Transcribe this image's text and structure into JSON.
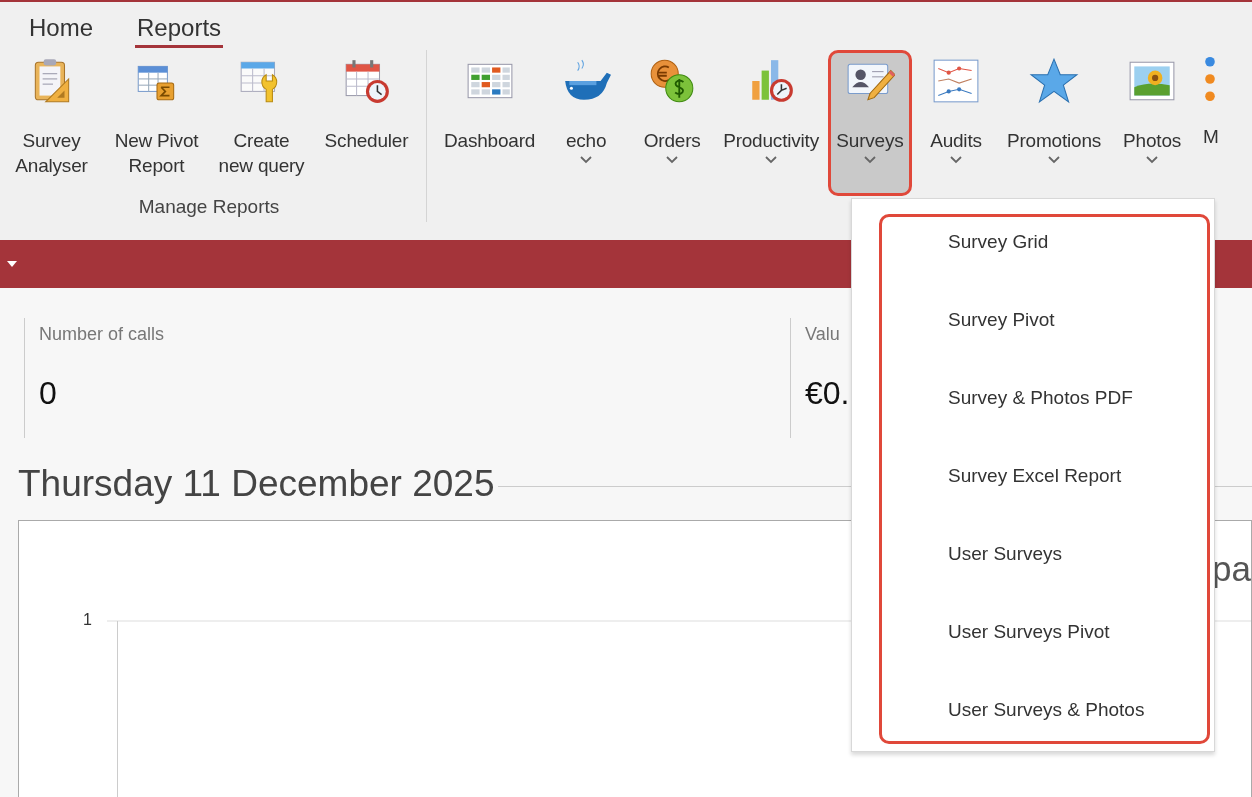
{
  "tabs": [
    {
      "label": "Home",
      "selected": false
    },
    {
      "label": "Reports",
      "selected": true
    }
  ],
  "ribbon_groups": [
    {
      "label": "Manage Reports",
      "buttons": [
        {
          "label": "Survey\nAnalyser",
          "dropdown": false,
          "selected": false,
          "highlighted": false
        },
        {
          "label": "New Pivot\nReport",
          "dropdown": false,
          "selected": false,
          "highlighted": false
        },
        {
          "label": "Create\nnew query",
          "dropdown": false,
          "selected": false,
          "highlighted": false
        },
        {
          "label": "Scheduler",
          "dropdown": false,
          "selected": false,
          "highlighted": false
        }
      ]
    },
    {
      "buttons": [
        {
          "label": "Dashboard",
          "dropdown": false,
          "selected": false,
          "highlighted": false
        },
        {
          "label": "echo",
          "dropdown": true,
          "selected": false,
          "highlighted": false
        },
        {
          "label": "Orders",
          "dropdown": true,
          "selected": false,
          "highlighted": false
        },
        {
          "label": "Productivity",
          "dropdown": true,
          "selected": false,
          "highlighted": false
        },
        {
          "label": "Surveys",
          "dropdown": true,
          "selected": true,
          "highlighted": true
        },
        {
          "label": "Audits",
          "dropdown": true,
          "selected": false,
          "highlighted": false
        },
        {
          "label": "Promotions",
          "dropdown": true,
          "selected": false,
          "highlighted": false
        },
        {
          "label": "Photos",
          "dropdown": true,
          "selected": false,
          "highlighted": false
        },
        {
          "label": "M",
          "dropdown": false,
          "selected": false,
          "highlighted": false
        }
      ]
    }
  ],
  "kpis": [
    {
      "label": "Number of calls",
      "value": "0"
    },
    {
      "label": "Valu",
      "value": "€0."
    }
  ],
  "date_heading": "Thursday 11 December 2025",
  "chart": {
    "title": "pa",
    "y_tick": "1"
  },
  "menu": {
    "highlighted": true,
    "items": [
      {
        "label": "Survey Grid"
      },
      {
        "label": "Survey Pivot"
      },
      {
        "label": "Survey & Photos PDF"
      },
      {
        "label": "Survey Excel Report"
      },
      {
        "label": "User Surveys"
      },
      {
        "label": "User Surveys Pivot"
      },
      {
        "label": "User Surveys & Photos"
      }
    ]
  }
}
